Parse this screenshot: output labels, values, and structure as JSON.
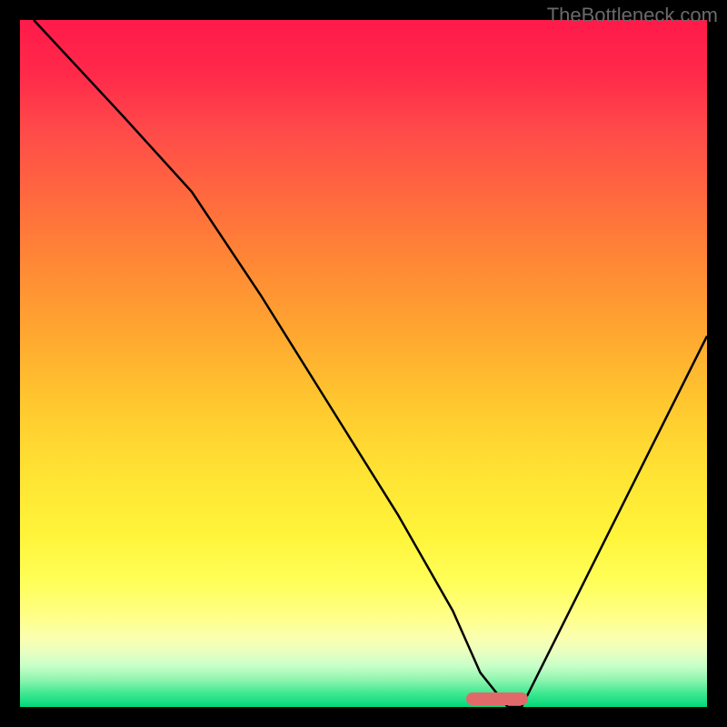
{
  "watermark": "TheBottleneck.com",
  "chart_data": {
    "type": "line",
    "title": "",
    "xlabel": "",
    "ylabel": "",
    "xlim": [
      0,
      100
    ],
    "ylim": [
      0,
      100
    ],
    "series": [
      {
        "name": "curve",
        "x": [
          2,
          15,
          25,
          35,
          45,
          55,
          63,
          67,
          71,
          73,
          78,
          85,
          92,
          100
        ],
        "values": [
          100,
          86,
          75,
          60,
          44,
          28,
          14,
          5,
          0,
          0,
          10,
          24,
          38,
          54
        ]
      }
    ],
    "marker": {
      "x_start": 65,
      "x_end": 74,
      "y": 1,
      "color": "#e06a6a"
    },
    "background_gradient": {
      "top": "#ff1a4a",
      "mid": "#ffe333",
      "bottom": "#00d87a"
    }
  }
}
